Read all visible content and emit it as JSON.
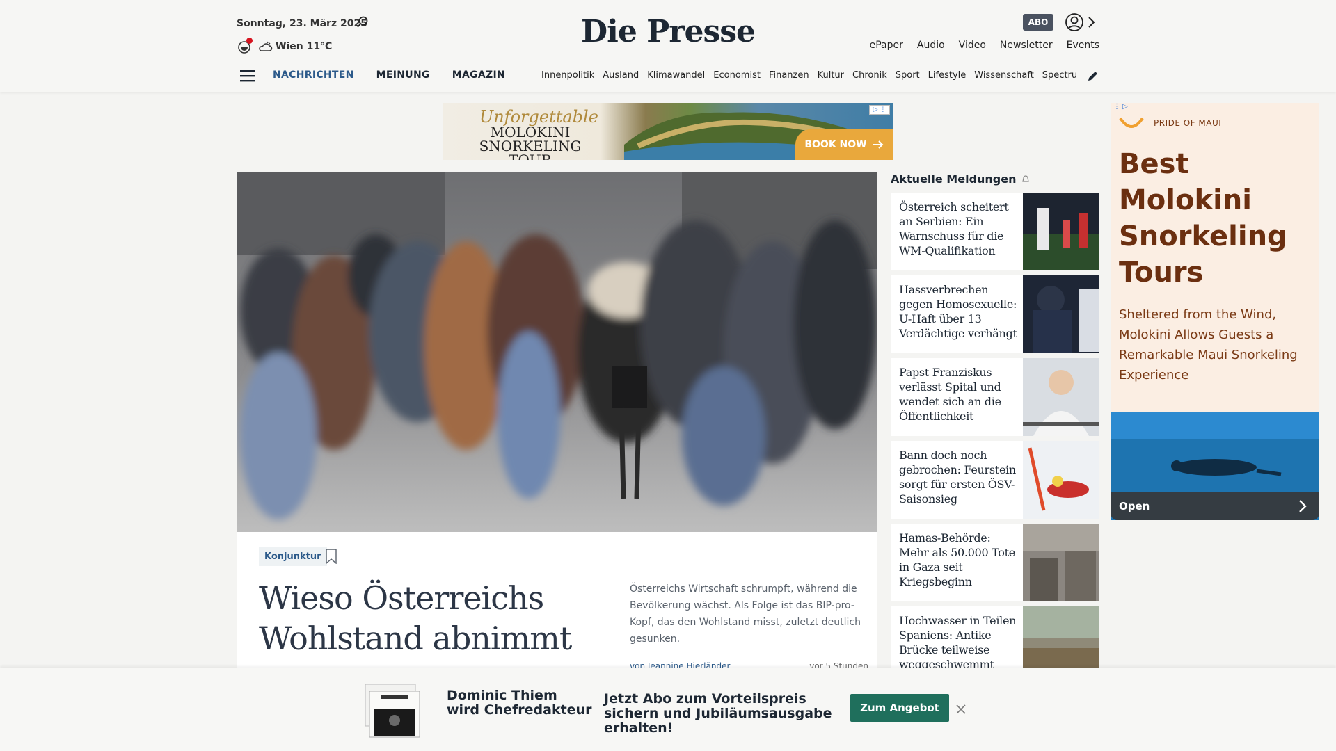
{
  "header": {
    "date": "Sonntag, 23. März 2025",
    "weather": "Wien 11°C",
    "logo": "Die Presse",
    "abo": "ABO",
    "top_links": [
      "ePaper",
      "Audio",
      "Video",
      "Newsletter",
      "Events"
    ],
    "main_nav": [
      "NACHRICHTEN",
      "MEINUNG",
      "MAGAZIN"
    ],
    "sub_nav": [
      "Innenpolitik",
      "Ausland",
      "Klimawandel",
      "Economist",
      "Finanzen",
      "Kultur",
      "Chronik",
      "Sport",
      "Lifestyle",
      "Wissenschaft",
      "Spectrum"
    ]
  },
  "top_ad": {
    "script": "Unforgettable",
    "title": "MOLOKINI SNORKELING TOUR",
    "cta": "BOOK NOW"
  },
  "hero": {
    "tag": "Konjunktur",
    "headline": "Wieso Österreichs Wohlstand abnimmt",
    "teaser": "Österreichs Wirtschaft schrumpft, während die Bevölkerung wächst. Als Folge ist das BIP-pro-Kopf, das den Wohlstand misst, zuletzt deutlich gesunken.",
    "byline": "von Jeannine Hierländer",
    "time": "vor 5 Stunden"
  },
  "news": {
    "title": "Aktuelle Meldungen",
    "items": [
      {
        "text": "Österreich scheitert an Serbien: Ein Warnschuss für die WM-Qualifikation"
      },
      {
        "text": "Hassverbrechen gegen Homosexuelle: U-Haft über 13 Verdächtige verhängt"
      },
      {
        "text": "Papst Franziskus verlässt Spital und wendet sich an die Öffentlichkeit"
      },
      {
        "text": "Bann doch noch gebrochen: Feurstein sorgt für ersten ÖSV-Saisonsieg"
      },
      {
        "text": "Hamas-Behörde: Mehr als 50.000 Tote in Gaza seit Kriegsbeginn"
      },
      {
        "text": "Hochwasser in Teilen Spaniens: Antike Brücke teilweise weggeschwemmt"
      }
    ]
  },
  "side_ad": {
    "brand": "PRIDE OF MAUI",
    "headline": "Best Molokini Snorkeling Tours",
    "sub": "Sheltered from the Wind, Molokini Allows Guests a Remarkable Maui Snorkeling Experience",
    "open": "Open"
  },
  "banner": {
    "line1": "Dominic Thiem wird Chefredakteur",
    "line2": "Jetzt Abo zum Vorteilspreis sichern und Jubiläumsausgabe erhalten!",
    "cta": "Zum Angebot"
  },
  "colors": {
    "accent": "#2c5a8a",
    "cta_green": "#1f6f5c",
    "ad_brown": "#6b2f10"
  }
}
